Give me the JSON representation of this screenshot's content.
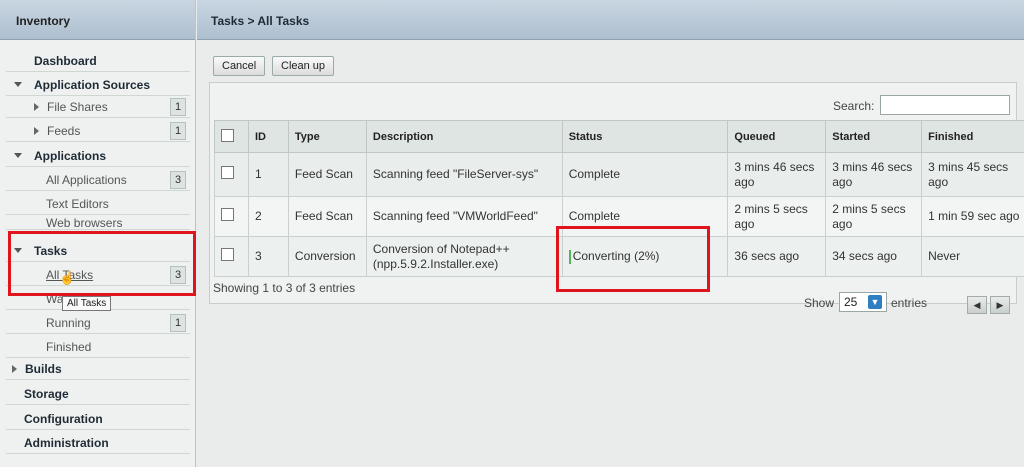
{
  "sidebar": {
    "title": "Inventory",
    "items": [
      {
        "label": "Dashboard"
      },
      {
        "label": "Application Sources"
      },
      {
        "label": "File Shares",
        "count": "1"
      },
      {
        "label": "Feeds",
        "count": "1"
      },
      {
        "label": "Applications"
      },
      {
        "label": "All Applications",
        "count": "3"
      },
      {
        "label": "Text Editors"
      },
      {
        "label": "Web browsers"
      },
      {
        "label": "Tasks"
      },
      {
        "label": "All Tasks",
        "count": "3"
      },
      {
        "label": "Wa"
      },
      {
        "label": "Running",
        "count": "1"
      },
      {
        "label": "Finished"
      },
      {
        "label": "Builds"
      },
      {
        "label": "Storage"
      },
      {
        "label": "Configuration"
      },
      {
        "label": "Administration"
      }
    ],
    "tooltip": "All Tasks"
  },
  "main": {
    "breadcrumb": "Tasks > All Tasks",
    "cancel_label": "Cancel",
    "cleanup_label": "Clean up",
    "search_label": "Search:",
    "search_value": "",
    "columns": [
      "ID",
      "Type",
      "Description",
      "Status",
      "Queued",
      "Started",
      "Finished"
    ],
    "rows": [
      {
        "id": "1",
        "type": "Feed Scan",
        "description": "Scanning feed \"FileServer-sys\"",
        "status": "Complete",
        "queued": "3 mins 46 secs ago",
        "started": "3 mins 46 secs ago",
        "finished": "3 mins 45 secs ago"
      },
      {
        "id": "2",
        "type": "Feed Scan",
        "description": "Scanning feed \"VMWorldFeed\"",
        "status": "Complete",
        "queued": "2 mins 5 secs ago",
        "started": "2 mins 5 secs ago",
        "finished": "1 min 59 sec ago"
      },
      {
        "id": "3",
        "type": "Conversion",
        "description": "Conversion of Notepad++ (npp.5.9.2.Installer.exe)",
        "status": "Converting (2%)",
        "progress": 0.02,
        "queued": "36 secs ago",
        "started": "34 secs ago",
        "finished": "Never"
      }
    ],
    "showing": "Showing 1 to 3 of 3 entries",
    "show_label": "Show",
    "page_size": "25",
    "entries_label": "entries",
    "prev_icon": "arrow-left-icon",
    "next_icon": "arrow-right-icon"
  },
  "colors": {
    "highlight": "#e0141c",
    "header": "#b9cad9",
    "progress": "#57b25a"
  }
}
